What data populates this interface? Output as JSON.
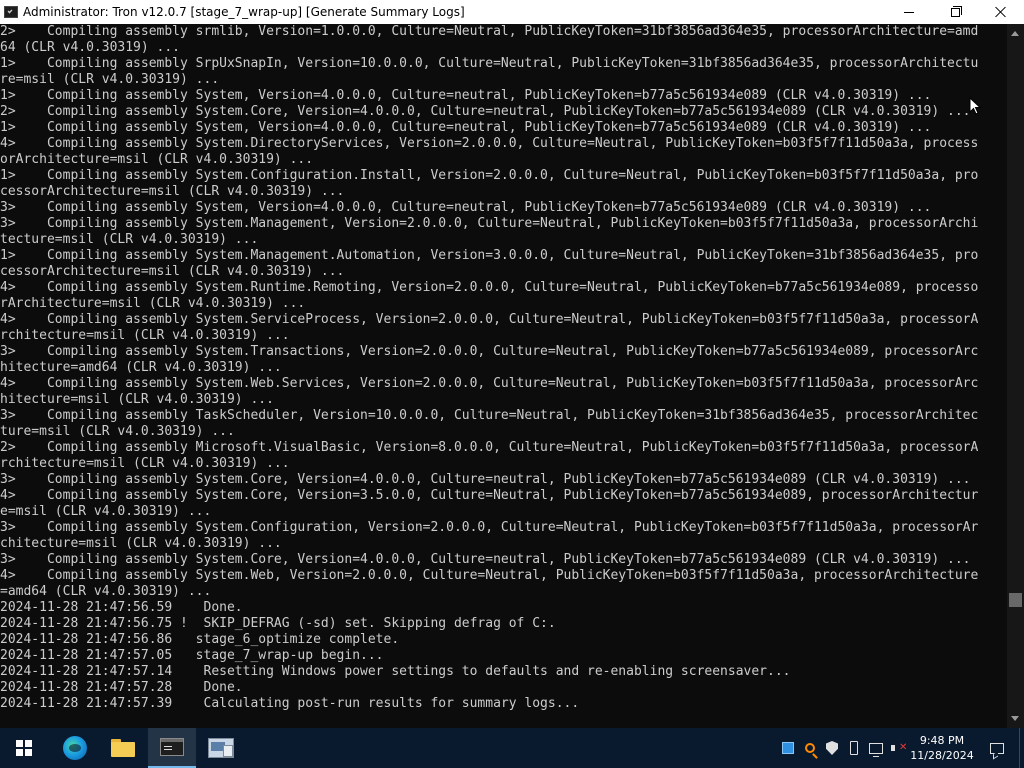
{
  "window": {
    "title": "Administrator:  Tron v12.0.7 [stage_7_wrap-up] [Generate Summary Logs]"
  },
  "console": {
    "lines": [
      "2>    Compiling assembly srmlib, Version=1.0.0.0, Culture=Neutral, PublicKeyToken=31bf3856ad364e35, processorArchitecture=amd",
      "64 (CLR v4.0.30319) ...",
      "1>    Compiling assembly SrpUxSnapIn, Version=10.0.0.0, Culture=Neutral, PublicKeyToken=31bf3856ad364e35, processorArchitectu",
      "re=msil (CLR v4.0.30319) ...",
      "1>    Compiling assembly System, Version=4.0.0.0, Culture=neutral, PublicKeyToken=b77a5c561934e089 (CLR v4.0.30319) ...",
      "2>    Compiling assembly System.Core, Version=4.0.0.0, Culture=neutral, PublicKeyToken=b77a5c561934e089 (CLR v4.0.30319) ...",
      "1>    Compiling assembly System, Version=4.0.0.0, Culture=neutral, PublicKeyToken=b77a5c561934e089 (CLR v4.0.30319) ...",
      "4>    Compiling assembly System.DirectoryServices, Version=2.0.0.0, Culture=Neutral, PublicKeyToken=b03f5f7f11d50a3a, process",
      "orArchitecture=msil (CLR v4.0.30319) ...",
      "1>    Compiling assembly System.Configuration.Install, Version=2.0.0.0, Culture=Neutral, PublicKeyToken=b03f5f7f11d50a3a, pro",
      "cessorArchitecture=msil (CLR v4.0.30319) ...",
      "3>    Compiling assembly System, Version=4.0.0.0, Culture=neutral, PublicKeyToken=b77a5c561934e089 (CLR v4.0.30319) ...",
      "3>    Compiling assembly System.Management, Version=2.0.0.0, Culture=Neutral, PublicKeyToken=b03f5f7f11d50a3a, processorArchi",
      "tecture=msil (CLR v4.0.30319) ...",
      "1>    Compiling assembly System.Management.Automation, Version=3.0.0.0, Culture=Neutral, PublicKeyToken=31bf3856ad364e35, pro",
      "cessorArchitecture=msil (CLR v4.0.30319) ...",
      "4>    Compiling assembly System.Runtime.Remoting, Version=2.0.0.0, Culture=Neutral, PublicKeyToken=b77a5c561934e089, processo",
      "rArchitecture=msil (CLR v4.0.30319) ...",
      "4>    Compiling assembly System.ServiceProcess, Version=2.0.0.0, Culture=Neutral, PublicKeyToken=b03f5f7f11d50a3a, processorA",
      "rchitecture=msil (CLR v4.0.30319) ...",
      "3>    Compiling assembly System.Transactions, Version=2.0.0.0, Culture=Neutral, PublicKeyToken=b77a5c561934e089, processorArc",
      "hitecture=amd64 (CLR v4.0.30319) ...",
      "4>    Compiling assembly System.Web.Services, Version=2.0.0.0, Culture=Neutral, PublicKeyToken=b03f5f7f11d50a3a, processorArc",
      "hitecture=msil (CLR v4.0.30319) ...",
      "3>    Compiling assembly TaskScheduler, Version=10.0.0.0, Culture=Neutral, PublicKeyToken=31bf3856ad364e35, processorArchitec",
      "ture=msil (CLR v4.0.30319) ...",
      "2>    Compiling assembly Microsoft.VisualBasic, Version=8.0.0.0, Culture=Neutral, PublicKeyToken=b03f5f7f11d50a3a, processorA",
      "rchitecture=msil (CLR v4.0.30319) ...",
      "3>    Compiling assembly System.Core, Version=4.0.0.0, Culture=neutral, PublicKeyToken=b77a5c561934e089 (CLR v4.0.30319) ...",
      "4>    Compiling assembly System.Core, Version=3.5.0.0, Culture=Neutral, PublicKeyToken=b77a5c561934e089, processorArchitectur",
      "e=msil (CLR v4.0.30319) ...",
      "3>    Compiling assembly System.Configuration, Version=2.0.0.0, Culture=Neutral, PublicKeyToken=b03f5f7f11d50a3a, processorAr",
      "chitecture=msil (CLR v4.0.30319) ...",
      "3>    Compiling assembly System.Core, Version=4.0.0.0, Culture=neutral, PublicKeyToken=b77a5c561934e089 (CLR v4.0.30319) ...",
      "4>    Compiling assembly System.Web, Version=2.0.0.0, Culture=Neutral, PublicKeyToken=b03f5f7f11d50a3a, processorArchitecture",
      "=amd64 (CLR v4.0.30319) ...",
      "2024-11-28 21:47:56.59    Done.",
      "2024-11-28 21:47:56.75 !  SKIP_DEFRAG (-sd) set. Skipping defrag of C:.",
      "2024-11-28 21:47:56.86   stage_6_optimize complete.",
      "2024-11-28 21:47:57.05   stage_7_wrap-up begin...",
      "2024-11-28 21:47:57.14    Resetting Windows power settings to defaults and re-enabling screensaver...",
      "2024-11-28 21:47:57.28    Done.",
      "2024-11-28 21:47:57.39    Calculating post-run results for summary logs..."
    ]
  },
  "taskbar": {
    "clock_time": "9:48 PM",
    "clock_date": "11/28/2024"
  },
  "colors": {
    "console_bg": "#0c0c0c",
    "console_text": "#cccccc",
    "taskbar_bg": "#0a1a2e",
    "active_accent": "#76b9ed"
  },
  "icons": {
    "start": "windows-logo-icon",
    "browser": "edge-icon",
    "files": "folder-icon",
    "console": "terminal-icon",
    "extra": "command-window-icon"
  }
}
